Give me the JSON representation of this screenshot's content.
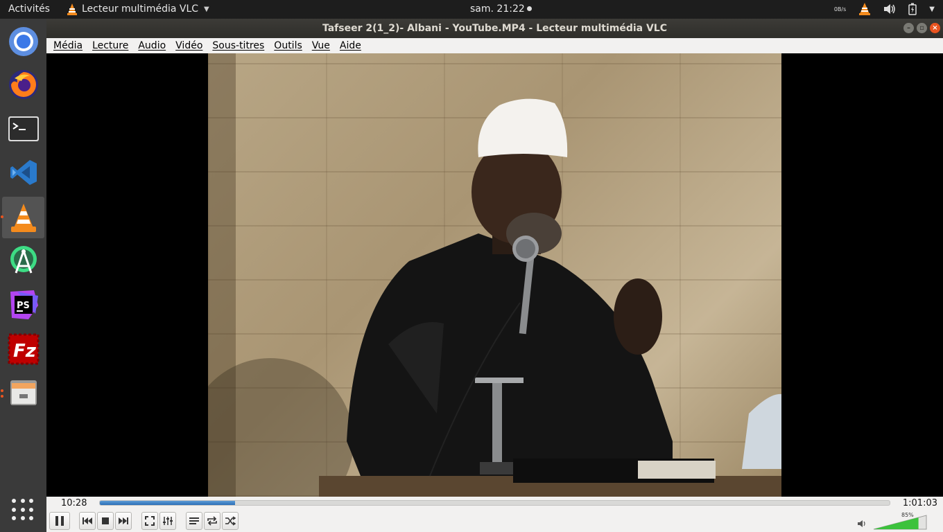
{
  "topbar": {
    "activities": "Activités",
    "app_menu_label": "Lecteur multimédia VLC",
    "clock": "sam. 21:22",
    "net_speed": "0B/s",
    "icons": [
      "vlc-tray-icon",
      "volume-icon",
      "battery-icon",
      "system-menu-caret-icon"
    ]
  },
  "dock": {
    "items": [
      {
        "name": "chromium",
        "icon": "chromium-icon",
        "running": false
      },
      {
        "name": "firefox",
        "icon": "firefox-icon",
        "running": false
      },
      {
        "name": "terminal",
        "icon": "terminal-icon",
        "running": false
      },
      {
        "name": "vscode",
        "icon": "vscode-icon",
        "running": false
      },
      {
        "name": "vlc",
        "icon": "vlc-icon",
        "running": true,
        "active": true
      },
      {
        "name": "android-studio",
        "icon": "android-studio-icon",
        "running": false
      },
      {
        "name": "phpstorm",
        "icon": "phpstorm-icon",
        "running": false
      },
      {
        "name": "filezilla",
        "icon": "filezilla-icon",
        "running": false
      },
      {
        "name": "files",
        "icon": "files-icon",
        "running": true
      }
    ],
    "show_apps_icon": "show-applications-icon"
  },
  "window": {
    "title": "Tafseer 2(1_2)- Albani - YouTube.MP4 - Lecteur multimédia VLC",
    "buttons": [
      "minimize",
      "maximize",
      "close"
    ]
  },
  "menu": [
    "Média",
    "Lecture",
    "Audio",
    "Vidéo",
    "Sous-titres",
    "Outils",
    "Vue",
    "Aide"
  ],
  "playback": {
    "elapsed": "10:28",
    "total": "1:01:03",
    "progress": 0.171
  },
  "controls": [
    "pause",
    "previous",
    "stop",
    "next",
    "fullscreen",
    "extended-settings",
    "playlist",
    "loop",
    "random"
  ],
  "volume": {
    "label": "85%",
    "level": 0.85
  },
  "colors": {
    "accent": "#e95420",
    "seek_fill": "#2b6fb8",
    "volume_fill": "#3cc23c"
  }
}
